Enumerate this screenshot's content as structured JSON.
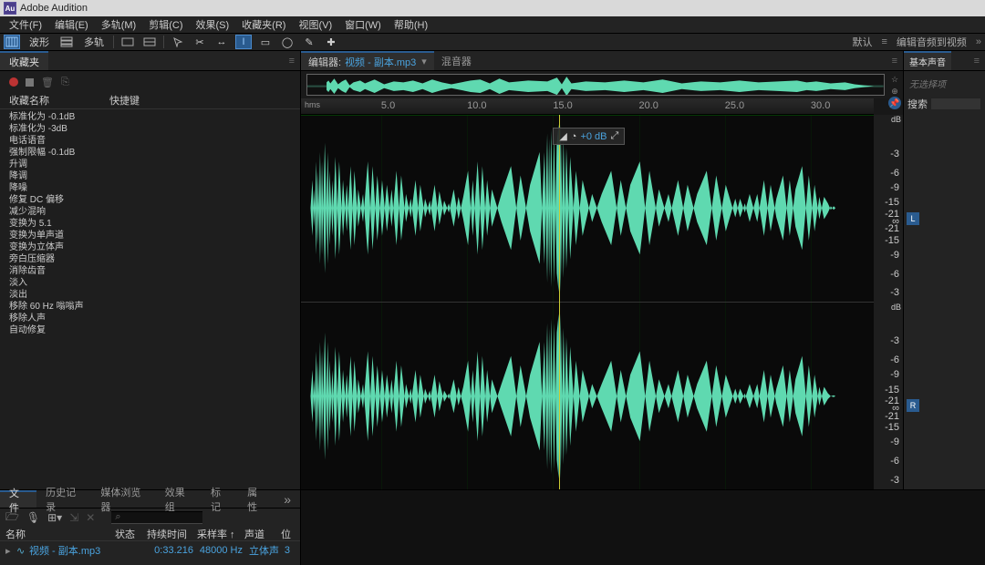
{
  "app": {
    "title": "Adobe Audition",
    "logo_text": "Au"
  },
  "menu": [
    "文件(F)",
    "编辑(E)",
    "多轨(M)",
    "剪辑(C)",
    "效果(S)",
    "收藏夹(R)",
    "视图(V)",
    "窗口(W)",
    "帮助(H)"
  ],
  "toolbar": {
    "mode_wave": "波形",
    "mode_multi": "多轨"
  },
  "workspace": {
    "default": "默认",
    "current": "编辑音频到视频"
  },
  "favorites": {
    "title": "收藏夹",
    "col_name": "收藏名称",
    "col_key": "快捷键",
    "items": [
      "标准化为 -0.1dB",
      "标准化为 -3dB",
      "电话语音",
      "强制限幅 -0.1dB",
      "升调",
      "降调",
      "降噪",
      "修复 DC 偏移",
      "减少混响",
      "变换为 5.1",
      "变换为单声道",
      "变换为立体声",
      "旁白压缩器",
      "消除齿音",
      "淡入",
      "淡出",
      "移除 60 Hz 嗡嗡声",
      "移除人声",
      "自动修复"
    ]
  },
  "editor": {
    "tab_label": "编辑器:",
    "filename": "视频 - 副本.mp3",
    "mixer_tab": "混音器",
    "timeline_unit": "hms",
    "ticks": [
      "5.0",
      "10.0",
      "15.0",
      "20.0",
      "25.0",
      "30.0"
    ],
    "db_unit": "dB",
    "db_marks": [
      "-3",
      "-6",
      "-9",
      "-15",
      "-21",
      "∞",
      "-21",
      "-15",
      "-9",
      "-6",
      "-3"
    ],
    "ch_left": "L",
    "ch_right": "R",
    "hud_db": "+0 dB"
  },
  "essential_sound": {
    "title": "基本声音",
    "no_selection": "无选择项",
    "search_label": "搜索"
  },
  "files_panel": {
    "tabs": [
      "文件",
      "历史记录",
      "媒体浏览器",
      "效果组",
      "标记",
      "属性"
    ],
    "headers": {
      "name": "名称",
      "status": "状态",
      "duration": "持续时间",
      "sample": "采样率 ↑",
      "channels": "声道",
      "bit": "位"
    },
    "row": {
      "name": "视频 - 副本.mp3",
      "duration": "0:33.216",
      "sample": "48000 Hz",
      "channels": "立体声",
      "bit": "3"
    }
  }
}
